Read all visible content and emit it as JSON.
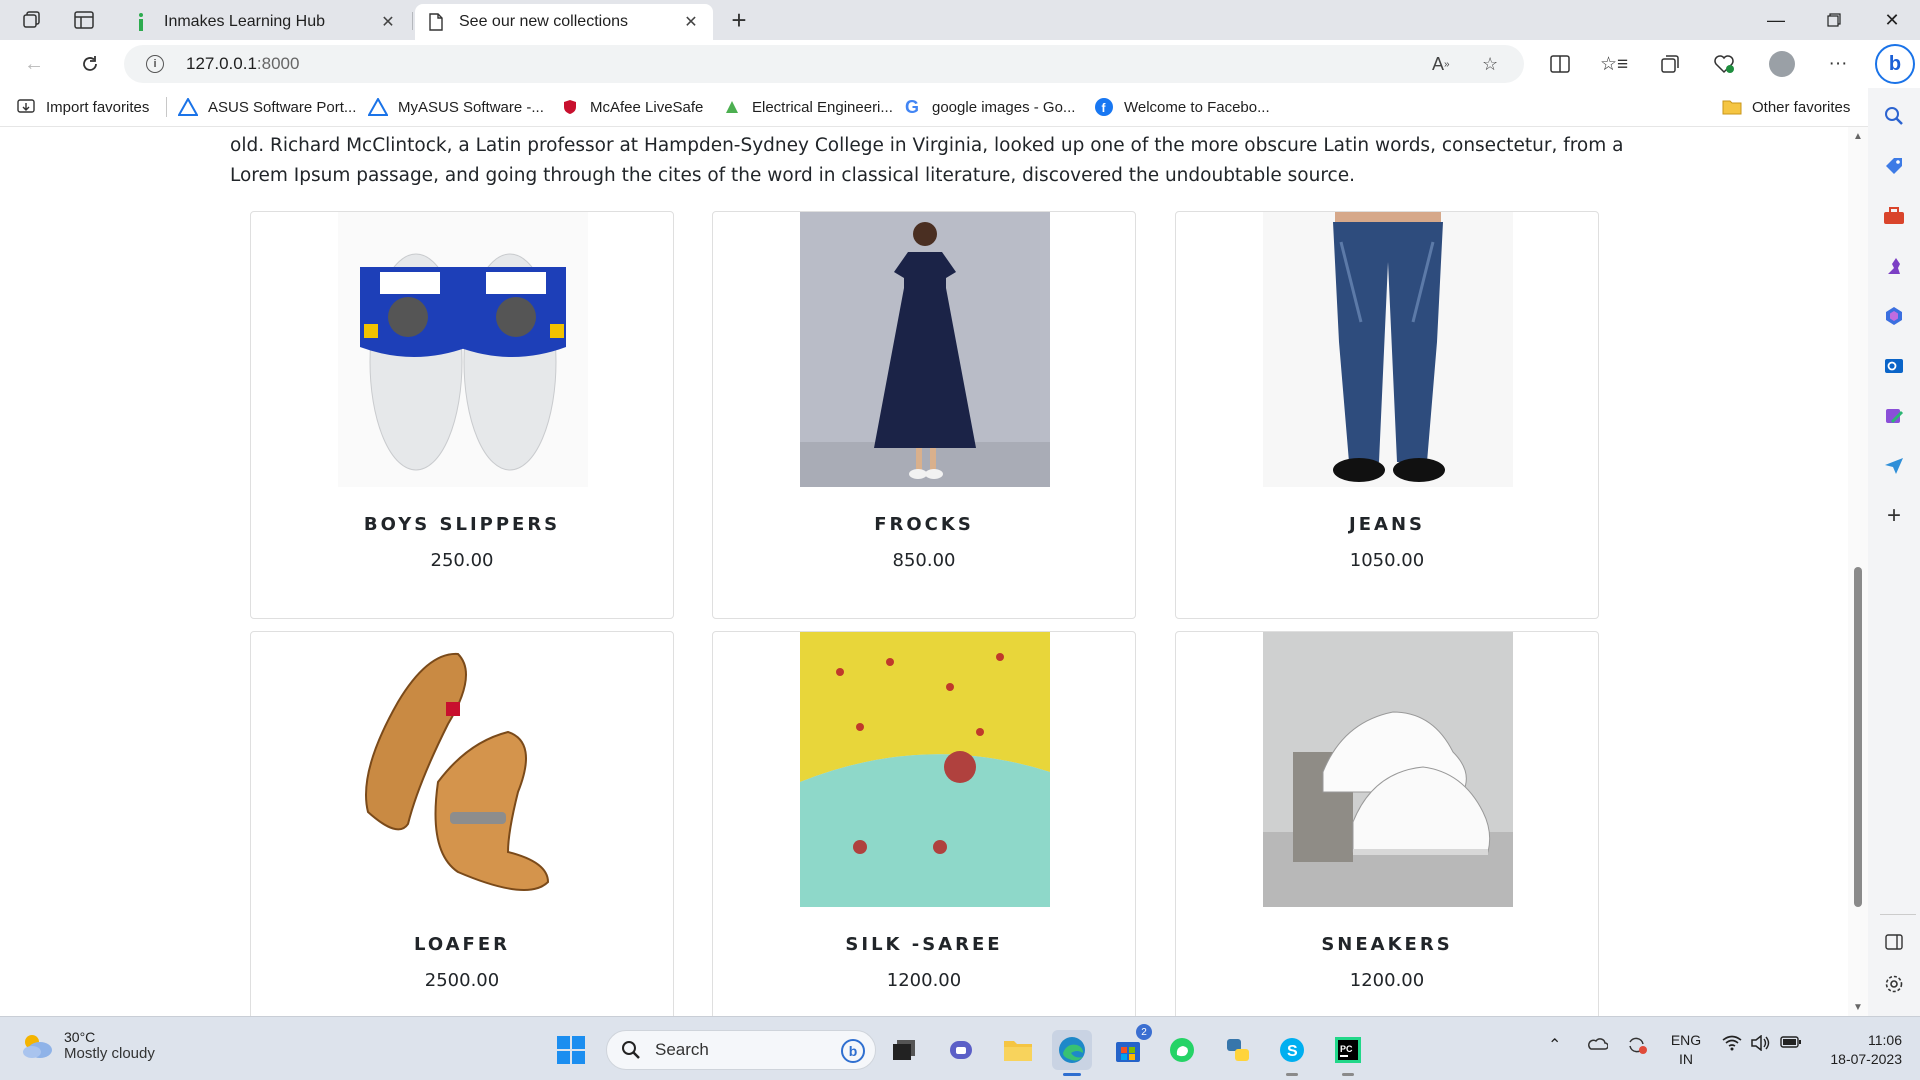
{
  "browser": {
    "tabs": [
      {
        "title": "Inmakes Learning Hub",
        "active": false
      },
      {
        "title": "See our new collections",
        "active": true
      }
    ],
    "url_host": "127.0.0.1",
    "url_port": ":8000",
    "favorites": [
      {
        "label": "Import favorites",
        "icon": "import-icon"
      },
      {
        "label": "ASUS Software Port...",
        "icon": "asus-icon"
      },
      {
        "label": "MyASUS Software -...",
        "icon": "asus-icon"
      },
      {
        "label": "McAfee LiveSafe",
        "icon": "mcafee-icon"
      },
      {
        "label": "Electrical Engineeri...",
        "icon": "electrical-icon"
      },
      {
        "label": "google images - Go...",
        "icon": "google-icon"
      },
      {
        "label": "Welcome to Facebo...",
        "icon": "facebook-icon"
      }
    ],
    "other_favorites": "Other favorites",
    "colors": {
      "accent": "#1a73e8",
      "facebook": "#1877f2"
    }
  },
  "page": {
    "intro_text": "old. Richard McClintock, a Latin professor at Hampden-Sydney College in Virginia, looked up one of the more obscure Latin words, consectetur, from a Lorem Ipsum passage, and going through the cites of the word in classical literature, discovered the undoubtable source.",
    "products": [
      {
        "name": "BOYS SLIPPERS",
        "price": "250.00",
        "image": "slippers"
      },
      {
        "name": "FROCKS",
        "price": "850.00",
        "image": "frock"
      },
      {
        "name": "JEANS",
        "price": "1050.00",
        "image": "jeans"
      },
      {
        "name": "LOAFER",
        "price": "2500.00",
        "image": "loafer"
      },
      {
        "name": "SILK -SAREE",
        "price": "1200.00",
        "image": "saree"
      },
      {
        "name": "SNEAKERS",
        "price": "1200.00",
        "image": "sneakers"
      }
    ]
  },
  "taskbar": {
    "weather_temp": "30°C",
    "weather_desc": "Mostly cloudy",
    "search_placeholder": "Search",
    "store_badge": "2",
    "lang_line1": "ENG",
    "lang_line2": "IN",
    "time": "11:06",
    "date": "18-07-2023"
  }
}
